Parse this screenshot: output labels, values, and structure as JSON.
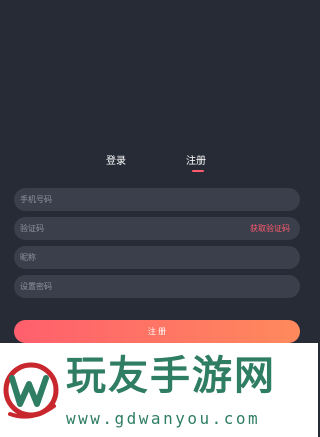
{
  "tabs": [
    {
      "label": "登录"
    },
    {
      "label": "注册"
    }
  ],
  "form": {
    "phone_placeholder": "手机号码",
    "code_placeholder": "验证码",
    "get_code_label": "获取验证码",
    "nickname_placeholder": "昵称",
    "password_placeholder": "设置密码",
    "submit_label": "注 册"
  },
  "watermark": {
    "title": "玩友手游网",
    "url": "www.gdwanyou.com"
  },
  "colors": {
    "background": "#272b36",
    "field": "#3a3f4b",
    "accent": "#ff5a6e",
    "gradient_start": "#ff5f6d",
    "gradient_end": "#ff8a5c",
    "watermark_green": "#2f7d63"
  }
}
